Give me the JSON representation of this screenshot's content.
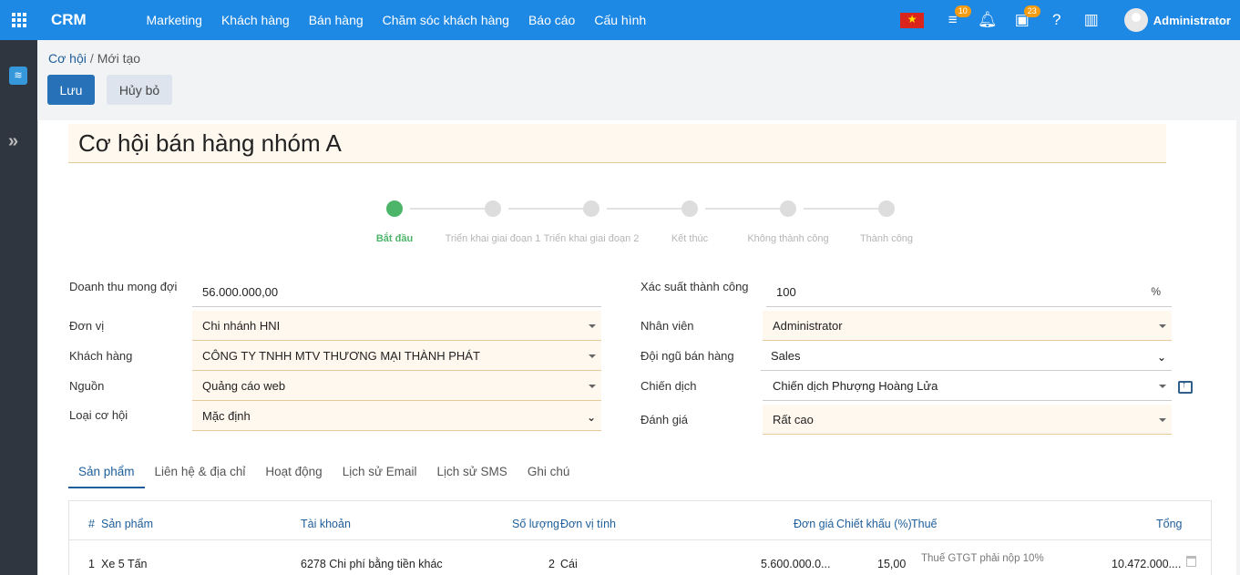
{
  "app": {
    "brand": "CRM"
  },
  "menu": [
    "Marketing",
    "Khách hàng",
    "Bán hàng",
    "Chăm sóc khách hàng",
    "Báo cáo",
    "Cấu hình"
  ],
  "top_right": {
    "activity_badge": "10",
    "calendar_badge": "23",
    "user": "Administrator"
  },
  "breadcrumb": {
    "parent": "Cơ hội",
    "separator": "/",
    "current": "Mới tạo"
  },
  "buttons": {
    "save": "Lưu",
    "cancel": "Hủy bỏ"
  },
  "record": {
    "title": "Cơ hội bán hàng nhóm A"
  },
  "stages": [
    {
      "label": "Bắt đầu",
      "active": true
    },
    {
      "label": "Triển khai giai đoạn 1",
      "active": false
    },
    {
      "label": "Triển khai giai đoạn 2",
      "active": false
    },
    {
      "label": "Kết thúc",
      "active": false
    },
    {
      "label": "Không thành công",
      "active": false
    },
    {
      "label": "Thành công",
      "active": false
    }
  ],
  "form": {
    "expected_revenue": {
      "label": "Doanh thu mong đợi",
      "value": "56.000.000,00"
    },
    "unit": {
      "label": "Đơn vị",
      "value": "Chi nhánh HNI"
    },
    "customer": {
      "label": "Khách hàng",
      "value": "CÔNG TY TNHH MTV THƯƠNG MẠI THÀNH PHÁT"
    },
    "source": {
      "label": "Nguồn",
      "value": "Quảng cáo web"
    },
    "opportunity_type": {
      "label": "Loại cơ hội",
      "value": "Mặc định"
    },
    "probability": {
      "label": "Xác suất thành công",
      "value": "100",
      "unit": "%"
    },
    "salesperson": {
      "label": "Nhân viên",
      "value": "Administrator"
    },
    "sales_team": {
      "label": "Đội ngũ bán hàng",
      "value": "Sales"
    },
    "campaign": {
      "label": "Chiến dịch",
      "value": "Chiến dịch Phượng Hoàng Lửa"
    },
    "rating": {
      "label": "Đánh giá",
      "value": "Rất cao"
    }
  },
  "tabs": [
    "Sản phẩm",
    "Liên hệ & địa chỉ",
    "Hoạt động",
    "Lịch sử Email",
    "Lịch sử SMS",
    "Ghi chú"
  ],
  "table": {
    "headers": [
      "#",
      "Sản phẩm",
      "Tài khoản",
      "Số lượng",
      "Đơn vị tính",
      "Đơn giá",
      "Chiết khấu (%)",
      "Thuế",
      "Tổng"
    ],
    "rows": [
      [
        "1",
        "Xe 5 Tấn",
        "6278 Chi phí bằng tiền khác",
        "2",
        "Cái",
        "5.600.000.0...",
        "15,00",
        "Thuế GTGT phải nộp 10%",
        "10.472.000...."
      ]
    ]
  },
  "colors": {
    "topbar": "#1e88e5",
    "sidebar": "#2f3640",
    "primary_button": "#2671b8",
    "active_stage": "#4db56a",
    "field_highlight": "#fff8ee"
  }
}
